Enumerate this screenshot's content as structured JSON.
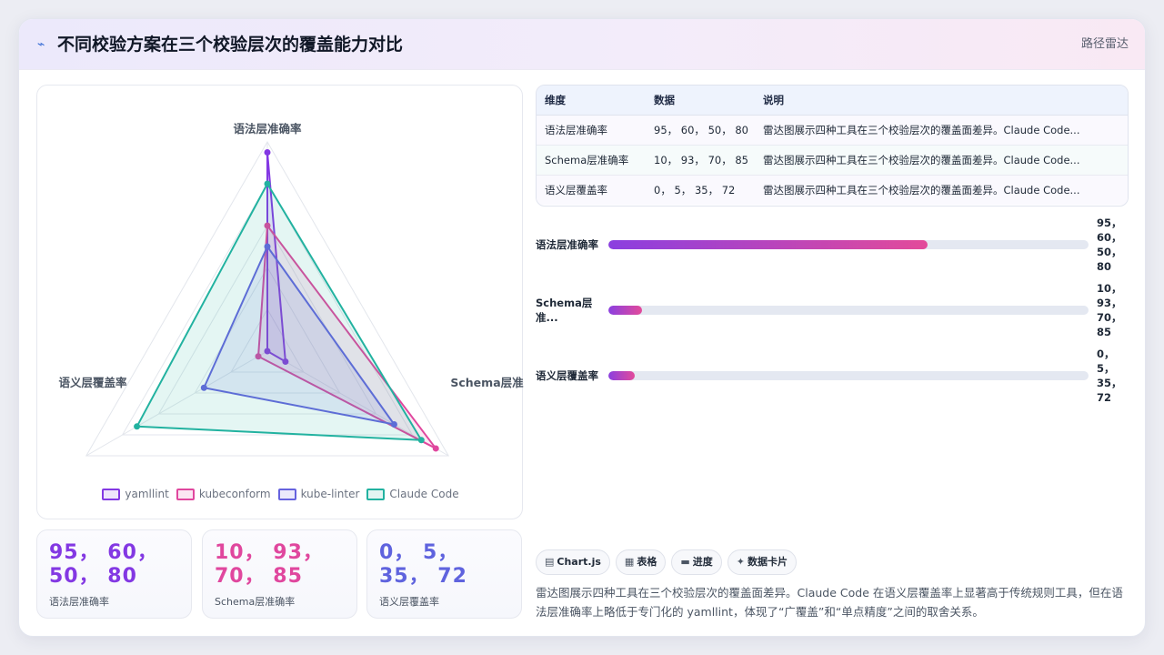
{
  "header": {
    "icon": "activity-line-icon",
    "title": "不同校验方案在三个校验层次的覆盖能力对比",
    "view_label": "路径雷达"
  },
  "chart_data": {
    "type": "radar",
    "axes": [
      "语法层准确率",
      "Schema层准确率",
      "语义层覆盖率"
    ],
    "range": [
      0,
      100
    ],
    "grid": true,
    "legend_position": "bottom",
    "series": [
      {
        "name": "yamllint",
        "values": [
          95,
          10,
          0
        ],
        "color": "#8338e3"
      },
      {
        "name": "kubeconform",
        "values": [
          60,
          93,
          5
        ],
        "color": "#e0479e"
      },
      {
        "name": "kube-linter",
        "values": [
          50,
          70,
          35
        ],
        "color": "#6663de"
      },
      {
        "name": "Claude Code",
        "values": [
          80,
          85,
          72
        ],
        "color": "#22b2a0"
      }
    ]
  },
  "stats": [
    {
      "value": "95， 60， 50， 80",
      "label": "语法层准确率",
      "color": "#8338e3"
    },
    {
      "value": "10， 93， 70， 85",
      "label": "Schema层准确率",
      "color": "#e0479e"
    },
    {
      "value": "0， 5， 35， 72",
      "label": "语义层覆盖率",
      "color": "#5f63de"
    }
  ],
  "table": {
    "headers": [
      "维度",
      "数据",
      "说明"
    ],
    "rows": [
      {
        "dimension": "语法层准确率",
        "data": "95， 60， 50， 80",
        "note": "雷达图展示四种工具在三个校验层次的覆盖面差异。Claude Code..."
      },
      {
        "dimension": "Schema层准确率",
        "data": "10， 93， 70， 85",
        "note": "雷达图展示四种工具在三个校验层次的覆盖面差异。Claude Code..."
      },
      {
        "dimension": "语义层覆盖率",
        "data": "0， 5， 35， 72",
        "note": "雷达图展示四种工具在三个校验层次的覆盖面差异。Claude Code..."
      }
    ]
  },
  "progress": [
    {
      "label": "语法层准确率",
      "fraction": 0.665,
      "value": "95，\n60，\n50，\n80"
    },
    {
      "label": "Schema层准...",
      "fraction": 0.07,
      "value": "10，\n93，\n70，\n85"
    },
    {
      "label": "语义层覆盖率",
      "fraction": 0.055,
      "value": "0，\n5，\n35，\n72"
    }
  ],
  "tags": [
    {
      "icon": "chart-icon",
      "glyph": "▤",
      "label": "Chart.js"
    },
    {
      "icon": "table-icon",
      "glyph": "▦",
      "label": "表格"
    },
    {
      "icon": "progress-icon",
      "glyph": "▬",
      "label": "进度"
    },
    {
      "icon": "sparkle-icon",
      "glyph": "✦",
      "label": "数据卡片"
    }
  ],
  "summary": "雷达图展示四种工具在三个校验层次的覆盖面差异。Claude Code 在语义层覆盖率上显著高于传统规则工具，但在语法层准确率上略低于专门化的 yamllint，体现了“广覆盖”和“单点精度”之间的取舍关系。"
}
